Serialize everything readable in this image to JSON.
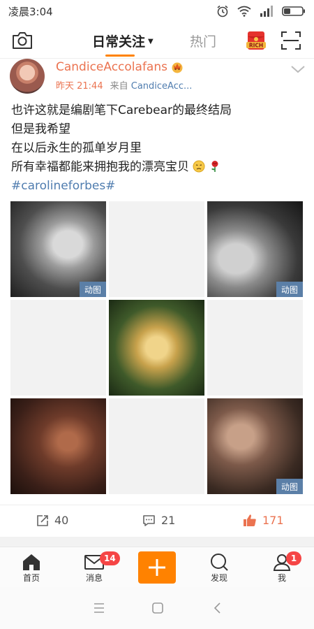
{
  "status_bar": {
    "time": "凌晨3:04"
  },
  "top_nav": {
    "tab_follow": "日常关注",
    "tab_hot": "热门",
    "red_packet_label": "RICH",
    "colors": {
      "accent": "#ff8200"
    }
  },
  "post": {
    "author": "CandiceAccolafans",
    "time": "昨天 21:44",
    "from_label": "来自",
    "source": "CandiceAcc...",
    "text_lines": [
      "也许这就是编剧笔下Carebear的最终结局",
      "但是我希望",
      "在以后永生的孤单岁月里",
      "所有幸福都能来拥抱我的漂亮宝贝"
    ],
    "hashtag": "#carolineforbes#",
    "gif_label": "动图",
    "emoji_icons": [
      "sad-face-icon",
      "rose-icon"
    ],
    "images": [
      {
        "name": "grid-image-1",
        "gif": true
      },
      {
        "name": "grid-image-2",
        "gif": false
      },
      {
        "name": "grid-image-3",
        "gif": true
      },
      {
        "name": "grid-image-4",
        "gif": false
      },
      {
        "name": "grid-image-5",
        "gif": false
      },
      {
        "name": "grid-image-6",
        "gif": false
      },
      {
        "name": "grid-image-7",
        "gif": false
      },
      {
        "name": "grid-image-8",
        "gif": false
      },
      {
        "name": "grid-image-9",
        "gif": true
      }
    ]
  },
  "actions": {
    "repost_count": "40",
    "comment_count": "21",
    "like_count": "171",
    "colors": {
      "like": "#eb7350"
    }
  },
  "tab_bar": {
    "home": "首页",
    "messages": "消息",
    "messages_badge": "14",
    "discover": "发现",
    "me": "我",
    "me_badge": "1"
  }
}
